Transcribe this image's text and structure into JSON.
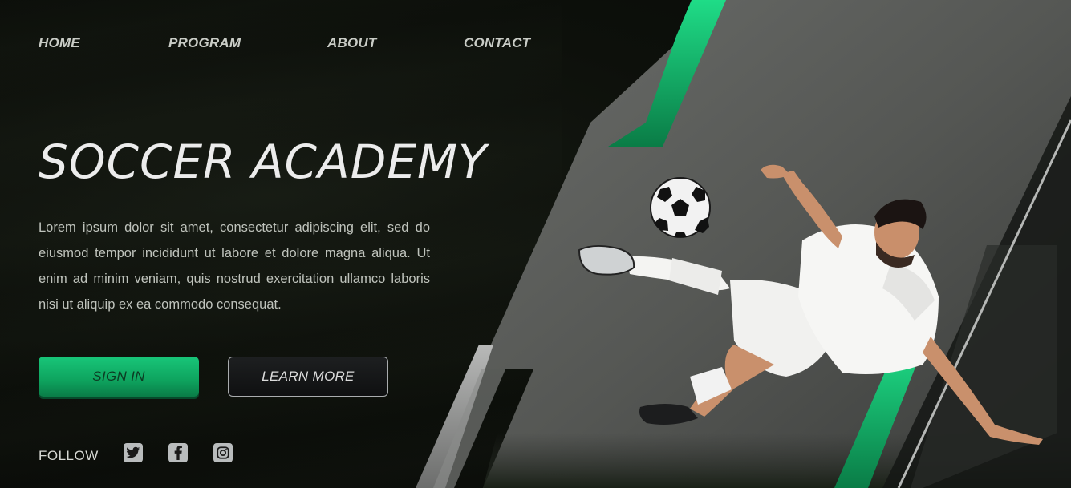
{
  "nav": {
    "items": [
      {
        "label": "HOME"
      },
      {
        "label": "PROGRAM"
      },
      {
        "label": "ABOUT"
      },
      {
        "label": "CONTACT"
      }
    ]
  },
  "hero": {
    "title": "SOCCER ACADEMY",
    "description": "Lorem ipsum dolor sit amet, consectetur adipiscing elit, sed do eiusmod tempor incididunt ut labore et dolore magna aliqua. Ut enim ad minim veniam, quis nostrud exercitation ullamco laboris nisi ut aliquip ex ea commodo consequat."
  },
  "buttons": {
    "signin_label": "SIGN IN",
    "learn_more_label": "LEARN MORE"
  },
  "follow": {
    "label": "FOLLOW",
    "icons": [
      "twitter-icon",
      "facebook-icon",
      "instagram-icon"
    ]
  },
  "colors": {
    "accent_green": "#0fb86b",
    "background": "#0b0d0a",
    "panel_gray": "#5a5c5a"
  }
}
